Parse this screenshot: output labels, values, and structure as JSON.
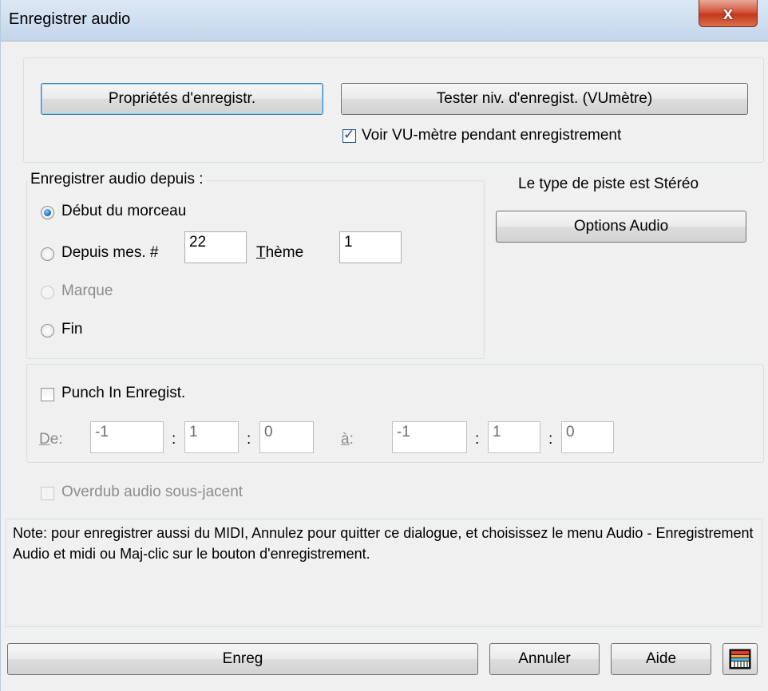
{
  "window": {
    "title": "Enregistrer audio",
    "close_glyph": "x"
  },
  "top": {
    "props_button": "Propriétés d'enregistr.",
    "test_button": "Tester niv. d'enregist. (VUmètre)",
    "vu_checkbox_label": "Voir VU-mètre pendant enregistrement",
    "vu_checked": true
  },
  "record_from": {
    "legend": "Enregistrer audio depuis :",
    "opt_start": "Début du morceau",
    "opt_bar": "Depuis mes. #",
    "bar_value": "22",
    "theme_label_u": "T",
    "theme_label_rest": "hème",
    "theme_value": "1",
    "opt_mark": "Marque",
    "opt_end": "Fin",
    "selected": "opt_start"
  },
  "track": {
    "type_text": "Le type de piste est Stéréo",
    "options_button": "Options Audio"
  },
  "punch": {
    "checkbox_label": "Punch In Enregist.",
    "checked": false,
    "from_label_u": "D",
    "from_label_rest": "e:",
    "from_values": [
      "-1",
      "1",
      "0"
    ],
    "to_label_u": "à",
    "to_label_rest": ":",
    "to_values": [
      "-1",
      "1",
      "0"
    ],
    "separator": ":"
  },
  "overdub": {
    "label": "Overdub audio sous-jacent",
    "checked": false
  },
  "note_text": "Note: pour enregistrer aussi du MIDI, Annulez pour quitter ce dialogue, et choisissez le menu Audio - Enregistrement Audio et midi ou Maj-clic sur le bouton d'enregistrement.",
  "footer": {
    "record_button": "Enreg",
    "cancel_button": "Annuler",
    "help_button": "Aide",
    "icon_button": "keyboard-icon"
  }
}
